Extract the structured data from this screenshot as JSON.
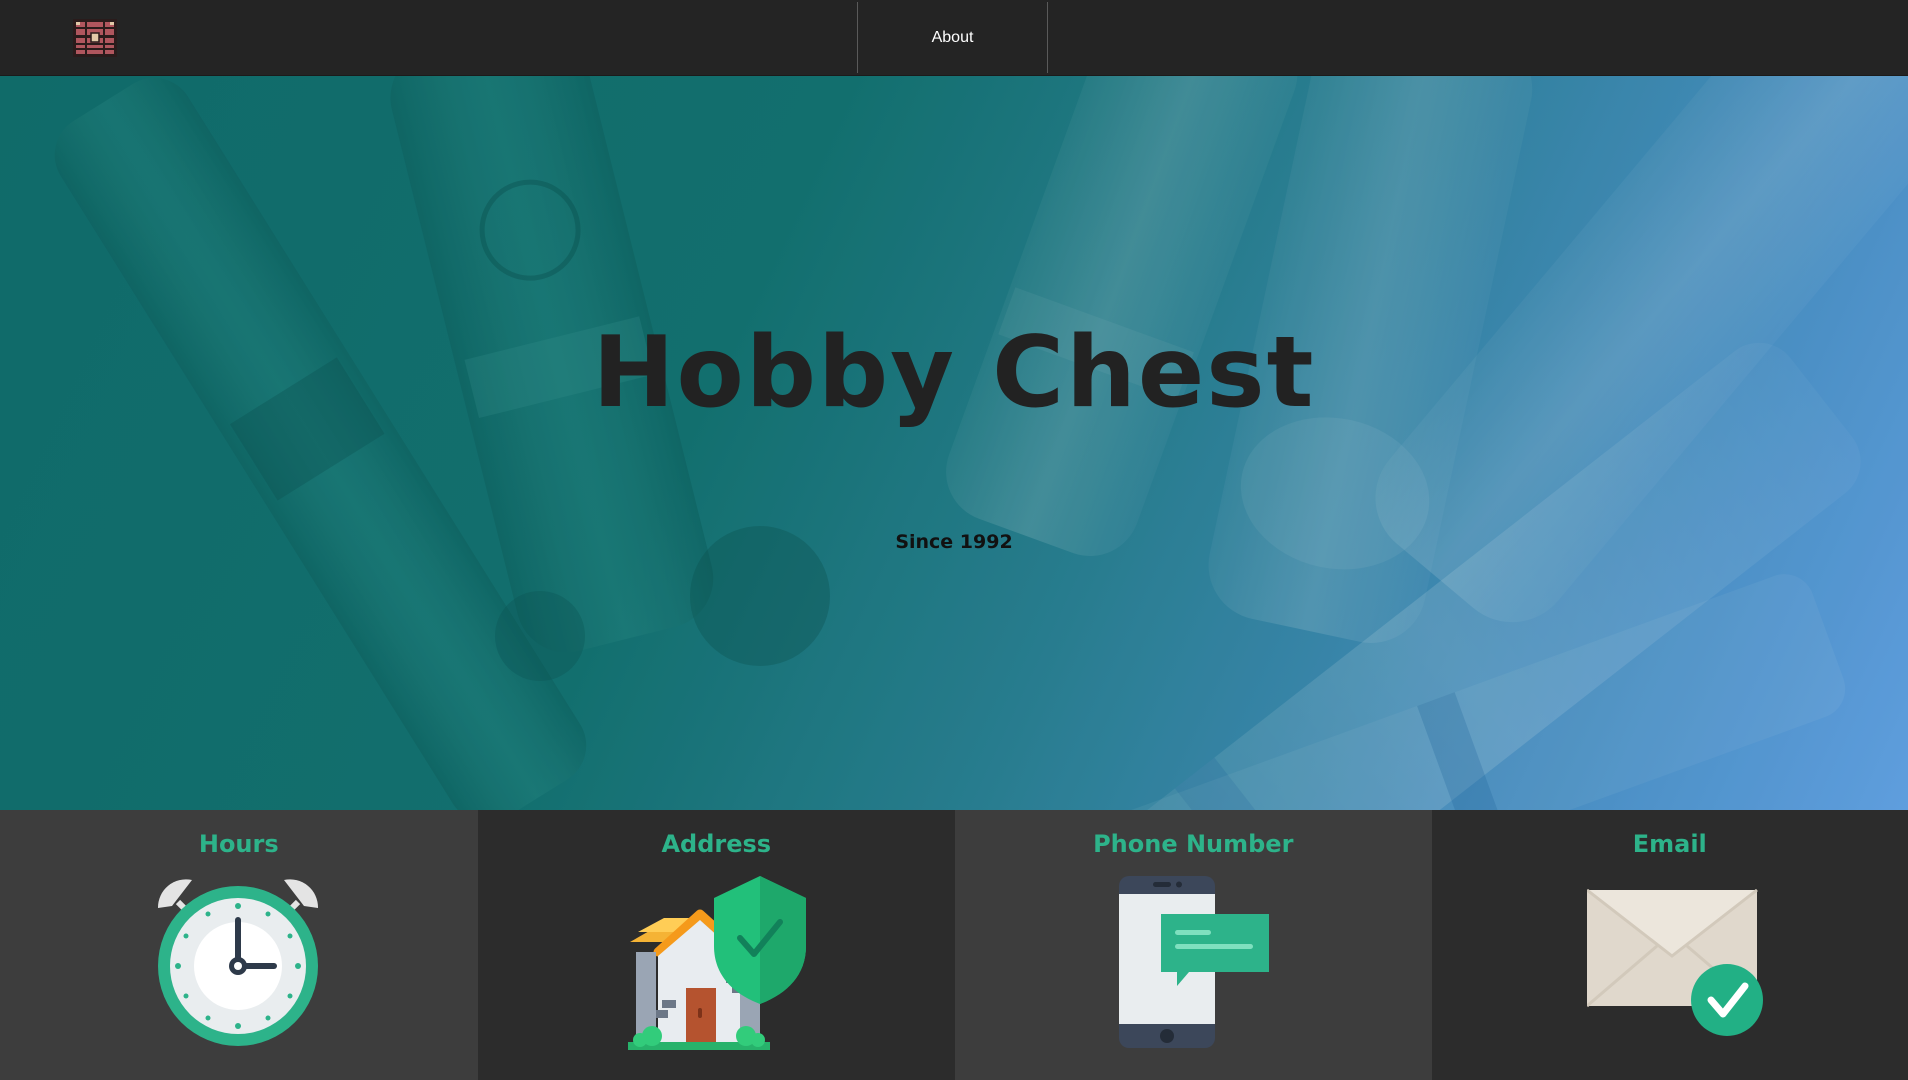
{
  "nav": {
    "logo_icon": "treasure-chest-icon",
    "about_label": "About"
  },
  "hero": {
    "title": "Hobby Chest",
    "subtitle": "Since 1992",
    "background": "paint-tubes-photo"
  },
  "info": {
    "hours": {
      "title": "Hours",
      "icon": "alarm-clock-icon"
    },
    "address": {
      "title": "Address",
      "icon": "house-shield-icon"
    },
    "phone": {
      "title": "Phone Number",
      "icon": "phone-message-icon"
    },
    "email": {
      "title": "Email",
      "icon": "envelope-check-icon"
    }
  },
  "colors": {
    "nav_bg": "#242424",
    "accent": "#2db38a",
    "hero_teal": "#116b69",
    "hero_blue": "#6aa5ee",
    "card_light": "#3d3d3d",
    "card_dark": "#2c2c2c"
  }
}
